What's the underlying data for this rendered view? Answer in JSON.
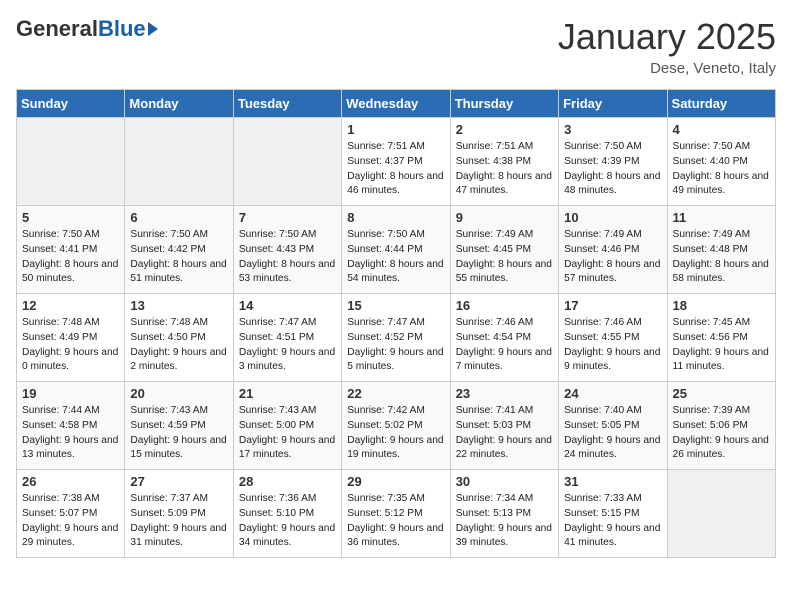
{
  "header": {
    "logo_general": "General",
    "logo_blue": "Blue",
    "month": "January 2025",
    "location": "Dese, Veneto, Italy"
  },
  "weekdays": [
    "Sunday",
    "Monday",
    "Tuesday",
    "Wednesday",
    "Thursday",
    "Friday",
    "Saturday"
  ],
  "weeks": [
    [
      {
        "day": "",
        "text": ""
      },
      {
        "day": "",
        "text": ""
      },
      {
        "day": "",
        "text": ""
      },
      {
        "day": "1",
        "text": "Sunrise: 7:51 AM\nSunset: 4:37 PM\nDaylight: 8 hours and 46 minutes."
      },
      {
        "day": "2",
        "text": "Sunrise: 7:51 AM\nSunset: 4:38 PM\nDaylight: 8 hours and 47 minutes."
      },
      {
        "day": "3",
        "text": "Sunrise: 7:50 AM\nSunset: 4:39 PM\nDaylight: 8 hours and 48 minutes."
      },
      {
        "day": "4",
        "text": "Sunrise: 7:50 AM\nSunset: 4:40 PM\nDaylight: 8 hours and 49 minutes."
      }
    ],
    [
      {
        "day": "5",
        "text": "Sunrise: 7:50 AM\nSunset: 4:41 PM\nDaylight: 8 hours and 50 minutes."
      },
      {
        "day": "6",
        "text": "Sunrise: 7:50 AM\nSunset: 4:42 PM\nDaylight: 8 hours and 51 minutes."
      },
      {
        "day": "7",
        "text": "Sunrise: 7:50 AM\nSunset: 4:43 PM\nDaylight: 8 hours and 53 minutes."
      },
      {
        "day": "8",
        "text": "Sunrise: 7:50 AM\nSunset: 4:44 PM\nDaylight: 8 hours and 54 minutes."
      },
      {
        "day": "9",
        "text": "Sunrise: 7:49 AM\nSunset: 4:45 PM\nDaylight: 8 hours and 55 minutes."
      },
      {
        "day": "10",
        "text": "Sunrise: 7:49 AM\nSunset: 4:46 PM\nDaylight: 8 hours and 57 minutes."
      },
      {
        "day": "11",
        "text": "Sunrise: 7:49 AM\nSunset: 4:48 PM\nDaylight: 8 hours and 58 minutes."
      }
    ],
    [
      {
        "day": "12",
        "text": "Sunrise: 7:48 AM\nSunset: 4:49 PM\nDaylight: 9 hours and 0 minutes."
      },
      {
        "day": "13",
        "text": "Sunrise: 7:48 AM\nSunset: 4:50 PM\nDaylight: 9 hours and 2 minutes."
      },
      {
        "day": "14",
        "text": "Sunrise: 7:47 AM\nSunset: 4:51 PM\nDaylight: 9 hours and 3 minutes."
      },
      {
        "day": "15",
        "text": "Sunrise: 7:47 AM\nSunset: 4:52 PM\nDaylight: 9 hours and 5 minutes."
      },
      {
        "day": "16",
        "text": "Sunrise: 7:46 AM\nSunset: 4:54 PM\nDaylight: 9 hours and 7 minutes."
      },
      {
        "day": "17",
        "text": "Sunrise: 7:46 AM\nSunset: 4:55 PM\nDaylight: 9 hours and 9 minutes."
      },
      {
        "day": "18",
        "text": "Sunrise: 7:45 AM\nSunset: 4:56 PM\nDaylight: 9 hours and 11 minutes."
      }
    ],
    [
      {
        "day": "19",
        "text": "Sunrise: 7:44 AM\nSunset: 4:58 PM\nDaylight: 9 hours and 13 minutes."
      },
      {
        "day": "20",
        "text": "Sunrise: 7:43 AM\nSunset: 4:59 PM\nDaylight: 9 hours and 15 minutes."
      },
      {
        "day": "21",
        "text": "Sunrise: 7:43 AM\nSunset: 5:00 PM\nDaylight: 9 hours and 17 minutes."
      },
      {
        "day": "22",
        "text": "Sunrise: 7:42 AM\nSunset: 5:02 PM\nDaylight: 9 hours and 19 minutes."
      },
      {
        "day": "23",
        "text": "Sunrise: 7:41 AM\nSunset: 5:03 PM\nDaylight: 9 hours and 22 minutes."
      },
      {
        "day": "24",
        "text": "Sunrise: 7:40 AM\nSunset: 5:05 PM\nDaylight: 9 hours and 24 minutes."
      },
      {
        "day": "25",
        "text": "Sunrise: 7:39 AM\nSunset: 5:06 PM\nDaylight: 9 hours and 26 minutes."
      }
    ],
    [
      {
        "day": "26",
        "text": "Sunrise: 7:38 AM\nSunset: 5:07 PM\nDaylight: 9 hours and 29 minutes."
      },
      {
        "day": "27",
        "text": "Sunrise: 7:37 AM\nSunset: 5:09 PM\nDaylight: 9 hours and 31 minutes."
      },
      {
        "day": "28",
        "text": "Sunrise: 7:36 AM\nSunset: 5:10 PM\nDaylight: 9 hours and 34 minutes."
      },
      {
        "day": "29",
        "text": "Sunrise: 7:35 AM\nSunset: 5:12 PM\nDaylight: 9 hours and 36 minutes."
      },
      {
        "day": "30",
        "text": "Sunrise: 7:34 AM\nSunset: 5:13 PM\nDaylight: 9 hours and 39 minutes."
      },
      {
        "day": "31",
        "text": "Sunrise: 7:33 AM\nSunset: 5:15 PM\nDaylight: 9 hours and 41 minutes."
      },
      {
        "day": "",
        "text": ""
      }
    ]
  ]
}
